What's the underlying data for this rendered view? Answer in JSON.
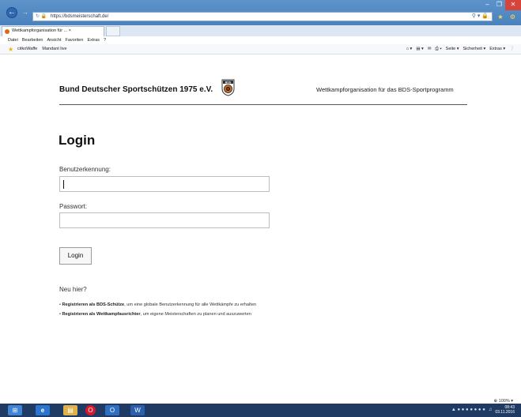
{
  "browser": {
    "address": "https://bdsmeisterschaft.de/",
    "tab_title": "Wettkampforganisation für ... ×",
    "menu": [
      "Datei",
      "Bearbeiten",
      "Ansicht",
      "Favoriten",
      "Extras",
      "?"
    ],
    "favorites": [
      "citkoWaffe",
      "Mandant live"
    ],
    "commands": [
      "Seite ▾",
      "Sicherheit ▾",
      "Extras ▾"
    ],
    "zoom": "⊕ 100% ▾"
  },
  "header": {
    "site_name": "Bund Deutscher Sportschützen 1975 e.V.",
    "logo_text": "BDS",
    "tagline": "Wettkampforganisation für das BDS-Sportprogramm"
  },
  "login": {
    "heading": "Login",
    "username_label": "Benutzerkennung:",
    "username_value": "",
    "password_label": "Passwort:",
    "password_value": "",
    "button_label": "Login"
  },
  "register": {
    "new_here": "Neu hier?",
    "item1_link": "Registrieren als BDS-Schütze",
    "item1_text": ", um eine globale Benutzerkennung für alle Wettkämpfe zu erhalten",
    "item2_link": "Registrieren als Wettkampfausrichter",
    "item2_text": ", um eigene Meisterschaften zu planen und auszuwerten"
  },
  "taskbar": {
    "clock_time": "08:43",
    "clock_date": "03.11.2016"
  },
  "colors": {
    "chrome_blue": "#4a82bd",
    "taskbar": "#1f3a63",
    "logo_orange": "#d86a1a"
  }
}
